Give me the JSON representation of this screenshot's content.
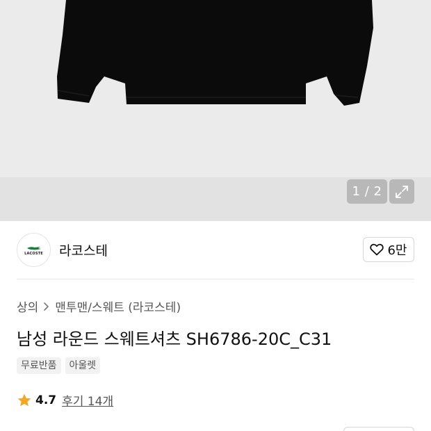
{
  "gallery": {
    "counter": "1 / 2",
    "expand_icon": "expand-icon"
  },
  "brand": {
    "logo_text": "LACOSTE",
    "name": "라코스테",
    "like_count": "6만",
    "like_icon": "heart-icon"
  },
  "breadcrumb": {
    "items": [
      "상의",
      "맨투맨/스웨트 (라코스테)"
    ],
    "separator_icon": "chevron-right-icon"
  },
  "product": {
    "title": "남성 라운드 스웨트셔츠 SH6786-20C_C31",
    "tags": [
      "무료반품",
      "아울렛"
    ]
  },
  "rating": {
    "score": "4.7",
    "reviews": "후기 14개",
    "star_color": "#f5a623"
  }
}
